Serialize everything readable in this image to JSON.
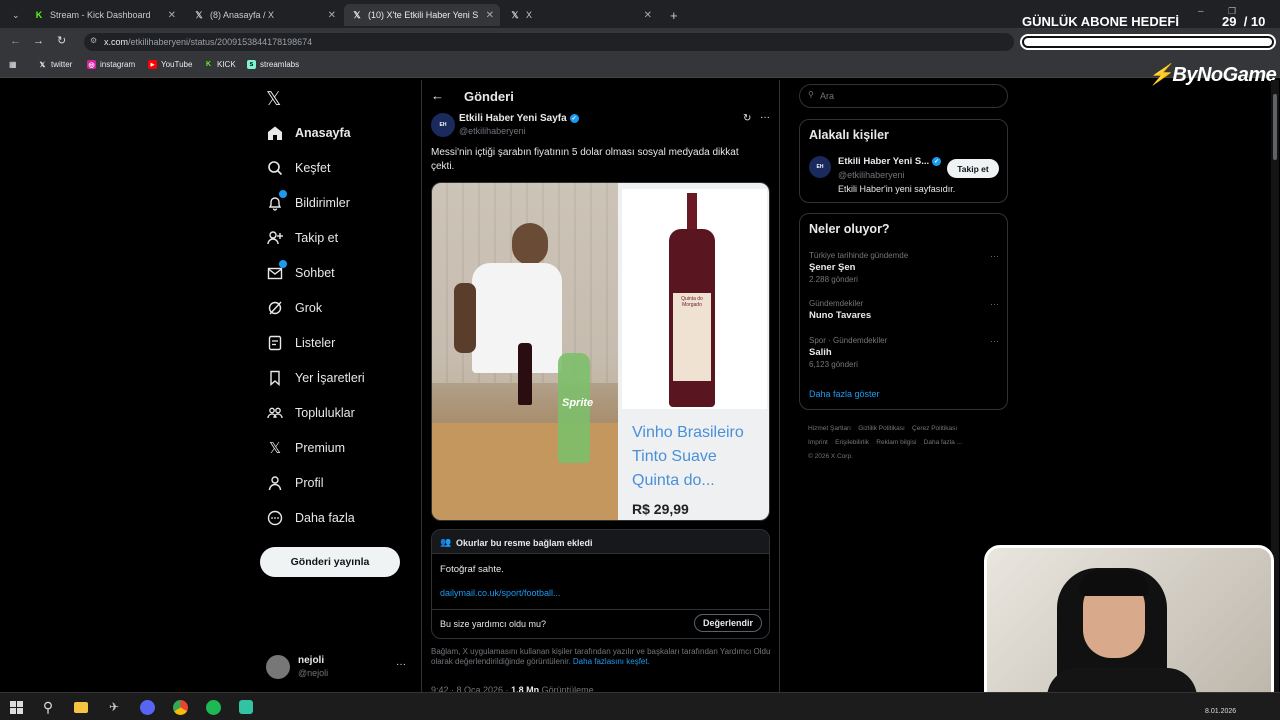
{
  "browser": {
    "tabs": [
      {
        "label": "Stream - Kick Dashboard",
        "icon": "kick-icon"
      },
      {
        "label": "(8) Anasayfa / X",
        "icon": "x-logo-icon"
      },
      {
        "label": "(10) X'te Etkili Haber Yeni Sayfa",
        "icon": "x-logo-icon"
      },
      {
        "label": "X",
        "icon": "x-logo-icon"
      }
    ],
    "url_domain": "x.com",
    "url_path": "/etkilihaberyeni/status/2009153844178198674",
    "bookmarks": [
      "twitter",
      "instagram",
      "YouTube",
      "KICK",
      "streamlabs"
    ]
  },
  "overlay": {
    "goal_title": "GÜNLÜK ABONE HEDEFİ",
    "goal_count": "29",
    "goal_total": "/ 10",
    "goal_progress": 1.0,
    "sponsor": "ByNoGame"
  },
  "nav": {
    "items": [
      "Anasayfa",
      "Keşfet",
      "Bildirimler",
      "Takip et",
      "Sohbet",
      "Grok",
      "Listeler",
      "Yer İşaretleri",
      "Topluluklar",
      "Premium",
      "Profil",
      "Daha fazla"
    ],
    "post_button": "Gönderi yayınla",
    "user_name": "nejoli",
    "user_handle": "@nejoli"
  },
  "post": {
    "header_title": "Gönderi",
    "author_name": "Etkili Haber Yeni Sayfa",
    "author_handle": "@etkilihaberyeni",
    "text": "Messi'nin içtiği şarabın fiyatının 5 dolar olması sosyal medyada dikkat çekti.",
    "product_name": "Vinho Brasileiro Tinto Suave Quinta do...",
    "product_price": "R$ 29,99",
    "bottle_label": "Quinta do Morgado",
    "note_title": "Okurlar bu resme bağlam ekledi",
    "note_text": "Fotoğraf sahte.",
    "note_link": "dailymail.co.uk/sport/football...",
    "helpful_question": "Bu size yardımcı oldu mu?",
    "rate_button": "Değerlendir",
    "note_footer": "Bağlam, X uygulamasını kullanan kişiler tarafından yazılır ve başkaları tarafından Yardımcı Oldu olarak değerlendirildiğinde görüntülenir.",
    "note_footer_link": "Daha fazlasını keşfet.",
    "meta_time": "9:42 · 8 Oca 2026 ·",
    "meta_views": "1,8 Mn",
    "meta_views_label": "Görüntüleme"
  },
  "sidebar": {
    "search_placeholder": "Ara",
    "related_title": "Alakalı kişiler",
    "related_name": "Etkili Haber Yeni S...",
    "related_handle": "@etkilihaberyeni",
    "related_bio": "Etkili Haber'in yeni sayfasıdır.",
    "follow_button": "Takip et",
    "trends_title": "Neler oluyor?",
    "trends": [
      {
        "context": "Türkiye tarihinde gündemde",
        "name": "Şener Şen",
        "count": "2.288 gönderi"
      },
      {
        "context": "Gündemdekiler",
        "name": "Nuno Tavares",
        "count": ""
      },
      {
        "context": "Spor · Gündemdekiler",
        "name": "Salih",
        "count": "6,123 gönderi"
      }
    ],
    "show_more": "Daha fazla göster",
    "footer_line1": [
      "Hizmet Şartları",
      "Gizlilik Politikası",
      "Çerez Politikası"
    ],
    "footer_line2": [
      "Imprint",
      "Erişilebilirlik",
      "Reklam bilgisi",
      "Daha fazla ..."
    ],
    "copyright": "© 2026 X Corp."
  },
  "taskbar": {
    "date": "8.01.2026"
  },
  "colors": {
    "accent": "#1d9bf0",
    "background": "#000000",
    "border": "#2f3336",
    "wine": "#5a1620",
    "product_link": "#4a90d9"
  }
}
